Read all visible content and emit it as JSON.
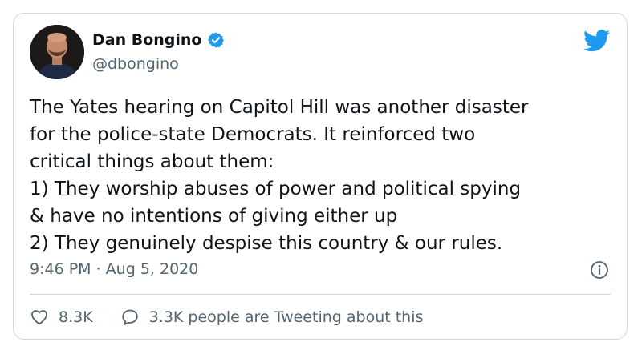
{
  "author": {
    "display_name": "Dan Bongino",
    "handle": "@dbongino",
    "verified": true,
    "avatar_icon": "profile-photo"
  },
  "tweet": {
    "text": "The Yates hearing on Capitol Hill was another disaster\nfor the police-state Democrats. It reinforced two\ncritical things about them:\n1) They worship abuses of power and political spying\n& have no intentions of giving either up\n2) They genuinely despise this country & our rules.",
    "timestamp": "9:46 PM · Aug 5, 2020"
  },
  "actions": {
    "likes": "8.3K",
    "conversation": "3.3K people are Tweeting about this"
  },
  "icons": {
    "brand": "twitter-bird-icon",
    "verified": "verified-badge-icon",
    "info": "info-icon",
    "like": "heart-icon",
    "reply": "speech-bubble-icon"
  },
  "colors": {
    "brand": "#1d9bf0",
    "text": "#0f1419",
    "secondary": "#536471",
    "border": "#cfd9de"
  }
}
